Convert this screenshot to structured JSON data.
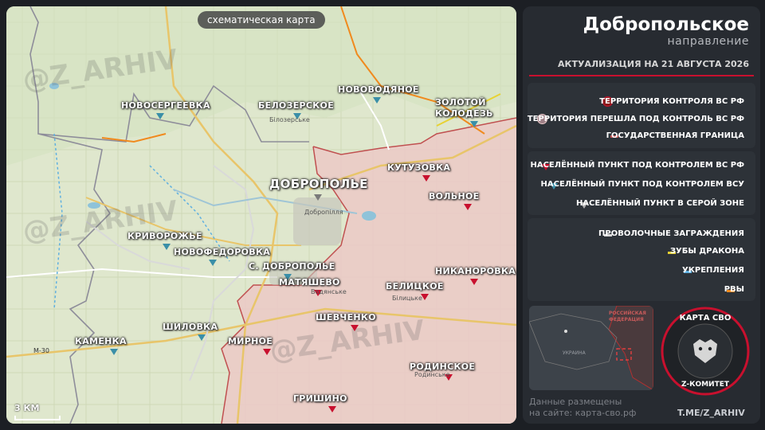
{
  "map": {
    "badge": "схематическая карта",
    "watermark": "@Z_ARHIV",
    "scale": "3 КМ",
    "towns_big": [
      {
        "name": "ДОБРОПОЛЬЕ",
        "status": "grey"
      }
    ],
    "towns": [
      {
        "name": "НОВОСЕРГЕЕВКА",
        "status": "blue"
      },
      {
        "name": "БЕЛОЗЕРСКОЕ",
        "status": "blue"
      },
      {
        "name": "НОВОВОДЯНОЕ",
        "status": "blue"
      },
      {
        "name": "ЗОЛОТОЙ",
        "status": "none"
      },
      {
        "name": "КОЛОДЕЗЬ",
        "status": "blue"
      },
      {
        "name": "КУТУЗОВКА",
        "status": "red"
      },
      {
        "name": "ВОЛЬНОЕ",
        "status": "red"
      },
      {
        "name": "КРИВОРОЖЬЕ",
        "status": "blue"
      },
      {
        "name": "НОВОФЕДОРОВКА",
        "status": "blue"
      },
      {
        "name": "С. ДОБРОПОЛЬЕ",
        "status": "blue"
      },
      {
        "name": "МАТЯШЕВО",
        "status": "red"
      },
      {
        "name": "БЕЛИЦКОЕ",
        "status": "red"
      },
      {
        "name": "НИКАНОРОВКА",
        "status": "red"
      },
      {
        "name": "ШЕВЧЕНКО",
        "status": "red"
      },
      {
        "name": "КАМЕНКА",
        "status": "blue"
      },
      {
        "name": "ШИЛОВКА",
        "status": "blue"
      },
      {
        "name": "МИРНОЕ",
        "status": "red"
      },
      {
        "name": "РОДИНСКОЕ",
        "status": "red"
      },
      {
        "name": "ГРИШИНО",
        "status": "red"
      }
    ],
    "sublabels": [
      "Білозерське",
      "Добропілля",
      "Водянське",
      "Білицьке",
      "Родинське",
      "М-30"
    ]
  },
  "panel": {
    "title": "Добропольское",
    "subtitle": "направление",
    "updated": "АКТУАЛИЗАЦИЯ НА 21 АВГУСТА 2026",
    "legend_territory": [
      "ТЕРРИТОРИЯ КОНТРОЛЯ ВС РФ",
      "ТЕРРИТОРИЯ ПЕРЕШЛА ПОД КОНТРОЛЬ ВС РФ",
      "ГОСУДАРСТВЕННАЯ ГРАНИЦА"
    ],
    "legend_towns": [
      "НАСЕЛЁННЫЙ ПУНКТ ПОД КОНТРОЛЕМ ВС РФ",
      "НАСЕЛЁННЫЙ ПУНКТ ПОД КОНТРОЛЕМ ВСУ",
      "НАСЕЛЁННЫЙ ПУНКТ В СЕРОЙ ЗОНЕ"
    ],
    "legend_defense": [
      "ПРОВОЛОЧНЫЕ ЗАГРАЖДЕНИЯ",
      "ЗУБЫ ДРАКОНА",
      "УКРЕПЛЕНИЯ",
      "РВЫ"
    ],
    "mini_map": {
      "russia": "РОССИЙСКАЯ ФЕДЕРАЦИЯ",
      "ukraine": "УКРАИНА"
    },
    "footer_line1": "Данные размещены",
    "footer_line2": "на сайте: карта-сво.рф",
    "telegram": "T.ME/Z_ARHIV",
    "logo_top": "КАРТА СВО",
    "logo_bottom": "Z-КОМИТЕТ"
  },
  "colors": {
    "rf_control": "#c8102e",
    "rf_taken": "#e9c9c9",
    "border": "#c05050",
    "town_rf": "#c8102e",
    "town_ua": "#3a8fa8",
    "town_grey": "#7a7a7a",
    "wire": "#d9d9d9",
    "teeth": "#e8d232",
    "fort": "#5fb0e0",
    "ditch": "#f08a1e"
  }
}
